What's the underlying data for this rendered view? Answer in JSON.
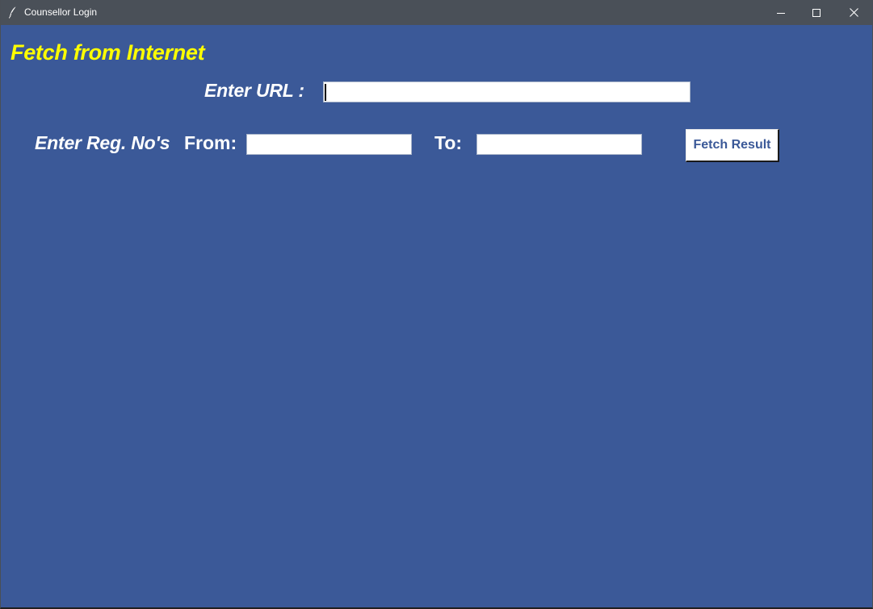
{
  "window": {
    "title": "Counsellor Login",
    "icon": "feather-icon",
    "controls": {
      "minimize_icon": "minimize-icon",
      "maximize_icon": "maximize-icon",
      "close_icon": "close-icon"
    }
  },
  "form": {
    "heading": "Fetch from Internet",
    "url_label": "Enter URL :",
    "url_value": "",
    "reg_label": "Enter Reg. No's",
    "from_label": "From:",
    "from_value": "",
    "to_label": "To:",
    "to_value": "",
    "fetch_button_label": "Fetch Result"
  },
  "colors": {
    "background": "#3b5998",
    "heading": "#ffff00",
    "label": "#ffffff",
    "button_text": "#3b5998",
    "titlebar": "#4a5058"
  }
}
